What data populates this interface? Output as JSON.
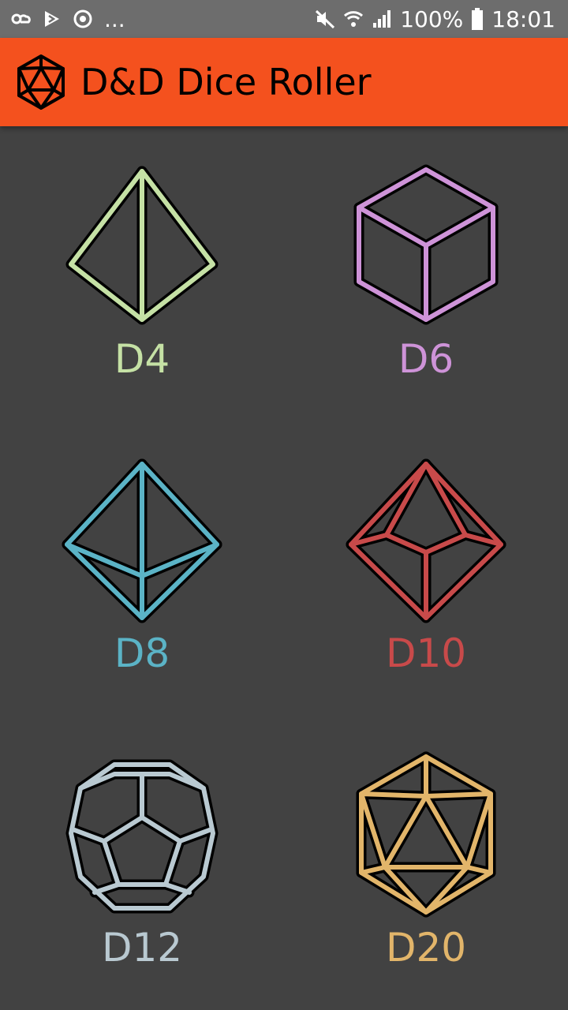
{
  "status_bar": {
    "overflow": "...",
    "battery": "100%",
    "time": "18:01"
  },
  "app_bar": {
    "title": "D&D Dice Roller",
    "icon": "d20-icon"
  },
  "dice": [
    {
      "label": "D4",
      "color": "#c5e1a5",
      "icon": "d4-icon"
    },
    {
      "label": "D6",
      "color": "#ce93d8",
      "icon": "d6-icon"
    },
    {
      "label": "D8",
      "color": "#5bb3c6",
      "icon": "d8-icon"
    },
    {
      "label": "D10",
      "color": "#c84a4a",
      "icon": "d10-icon"
    },
    {
      "label": "D12",
      "color": "#b9c9d1",
      "icon": "d12-icon"
    },
    {
      "label": "D20",
      "color": "#e2b56a",
      "icon": "d20-icon"
    }
  ]
}
